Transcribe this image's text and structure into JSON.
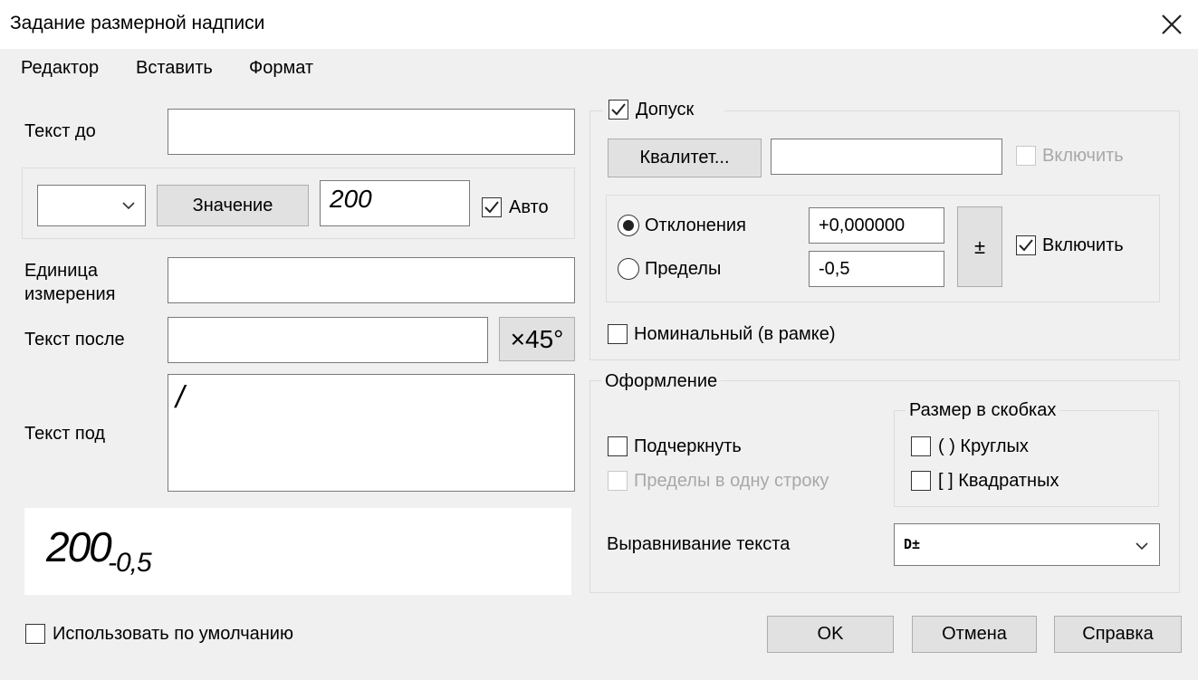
{
  "window": {
    "title": "Задание размерной надписи"
  },
  "menu": {
    "editor": "Редактор",
    "insert": "Вставить",
    "format": "Формат"
  },
  "left": {
    "text_before_label": "Текст до",
    "value_button": "Значение",
    "value_text": "200",
    "auto_label": "Авто",
    "unit_label_1": "Единица",
    "unit_label_2": "измерения",
    "text_after_label": "Текст после",
    "x45_button": "×45°",
    "text_under_label": "Текст под",
    "text_under_value": "/",
    "preview_main": "200",
    "preview_sub": "-0,5",
    "use_default_label": "Использовать по умолчанию"
  },
  "tolerance": {
    "label": "Допуск",
    "qualitet_button": "Квалитет...",
    "include_label": "Включить",
    "deviations_label": "Отклонения",
    "limits_label": "Пределы",
    "upper_value": "+0,000000",
    "lower_value": "-0,5",
    "plusminus_button": "±",
    "include_label_2": "Включить",
    "nominal_label": "Номинальный (в рамке)"
  },
  "design": {
    "legend": "Оформление",
    "underline_label": "Подчеркнуть",
    "limits_one_line_label": "Пределы в одну строку",
    "brackets_legend": "Размер в скобках",
    "round_label": "( ) Круглых",
    "square_label": "[ ] Квадратных",
    "align_label": "Выравнивание текста",
    "align_value": "D±"
  },
  "footer": {
    "ok": "OK",
    "cancel": "Отмена",
    "help": "Справка"
  }
}
